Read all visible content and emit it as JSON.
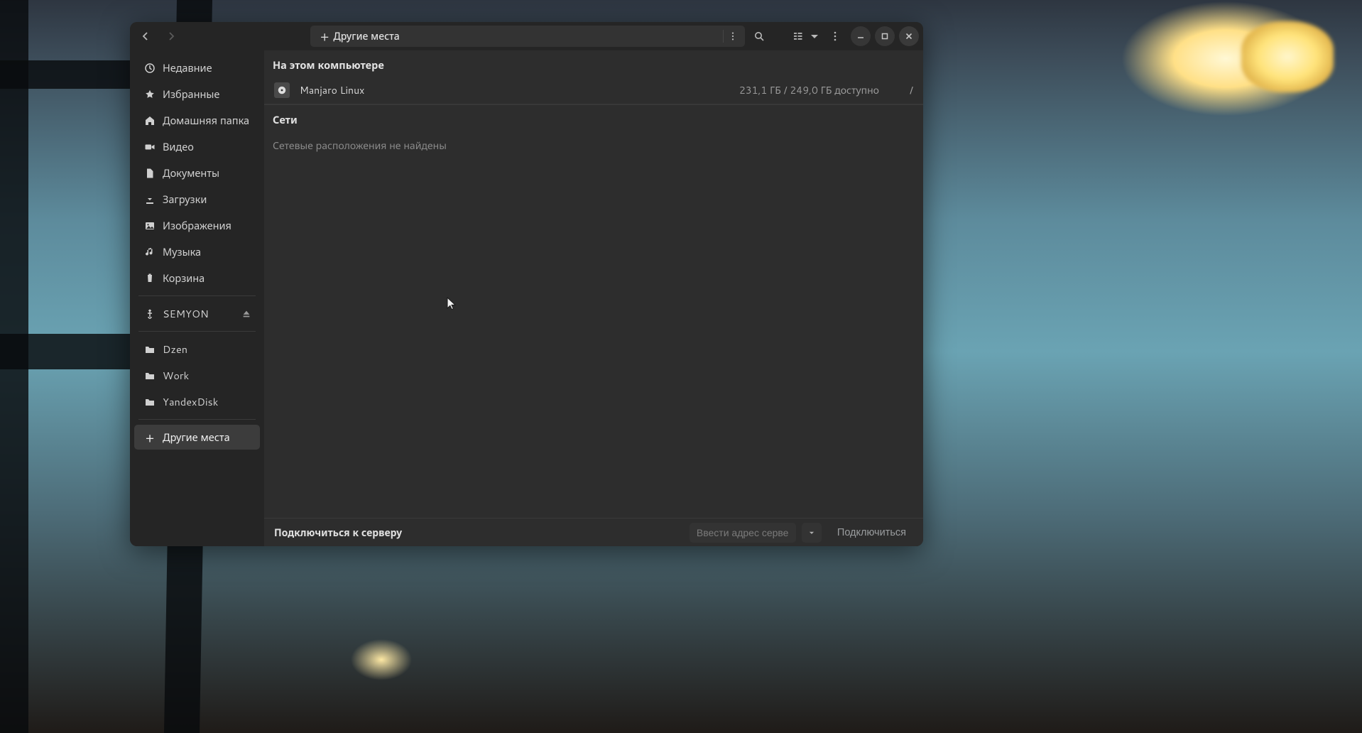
{
  "pathbar": {
    "label": "Другие места"
  },
  "sidebar": {
    "items": [
      {
        "label": "Недавние"
      },
      {
        "label": "Избранные"
      },
      {
        "label": "Домашняя папка"
      },
      {
        "label": "Видео"
      },
      {
        "label": "Документы"
      },
      {
        "label": "Загрузки"
      },
      {
        "label": "Изображения"
      },
      {
        "label": "Музыка"
      },
      {
        "label": "Корзина"
      }
    ],
    "devices": [
      {
        "label": "SEMYON"
      }
    ],
    "bookmarks": [
      {
        "label": "Dzen"
      },
      {
        "label": "Work"
      },
      {
        "label": "YandexDisk"
      }
    ],
    "other": {
      "label": "Другие места"
    }
  },
  "main": {
    "section_computer": "На этом компьютере",
    "volumes": [
      {
        "name": "Manjaro Linux",
        "capacity": "231,1 ГБ / 249,0 ГБ доступно",
        "mount": "/"
      }
    ],
    "section_network": "Сети",
    "network_empty": "Сетевые расположения не найдены"
  },
  "footer": {
    "label": "Подключиться к серверу",
    "input_placeholder": "Ввести адрес сервера…",
    "connect": "Подключиться"
  }
}
